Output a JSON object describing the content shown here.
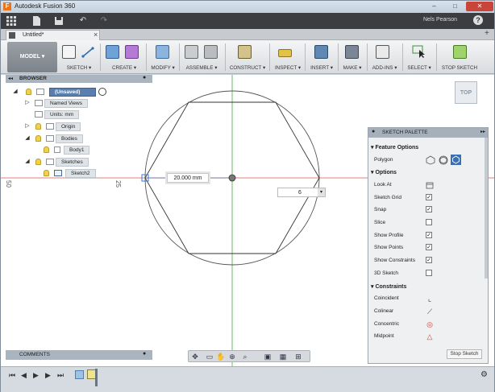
{
  "window": {
    "title": "Autodesk Fusion 360",
    "app_icon": "F",
    "minimize": "–",
    "maximize": "□",
    "close": "✕"
  },
  "quickbar": {
    "user_name": "Nels Pearson",
    "help": "?"
  },
  "document": {
    "tab_label": "Untitled*",
    "close": "×",
    "add_tab": "+"
  },
  "toolbar": {
    "workspace": "MODEL",
    "groups": [
      {
        "label": "SKETCH"
      },
      {
        "label": "CREATE"
      },
      {
        "label": "MODIFY"
      },
      {
        "label": "ASSEMBLE"
      },
      {
        "label": "CONSTRUCT"
      },
      {
        "label": "INSPECT"
      },
      {
        "label": "INSERT"
      },
      {
        "label": "MAKE"
      },
      {
        "label": "ADD-INS"
      },
      {
        "label": "SELECT"
      },
      {
        "label": "STOP SKETCH"
      }
    ]
  },
  "browser": {
    "title": "BROWSER",
    "nodes": [
      {
        "label": "(Unsaved)"
      },
      {
        "label": "Named Views"
      },
      {
        "label": "Units: mm"
      },
      {
        "label": "Origin"
      },
      {
        "label": "Bodies"
      },
      {
        "label": "Body1"
      },
      {
        "label": "Sketches"
      },
      {
        "label": "Sketch2"
      }
    ]
  },
  "canvas": {
    "viewcube": "TOP",
    "ruler_labels": [
      "50",
      "25"
    ],
    "dimension_value": "20.000 mm",
    "sides_value": "6",
    "colors": {
      "x_axis": "#d9544c",
      "y_axis": "#3fae3f",
      "sketch": "#333333",
      "construction": "#666666"
    }
  },
  "palette": {
    "title": "SKETCH PALETTE",
    "feature_options": {
      "header": "Feature Options",
      "polygon_label": "Polygon",
      "polygon_types": [
        "circumscribed-polygon-icon",
        "inscribed-polygon-icon",
        "edge-polygon-icon"
      ]
    },
    "options": {
      "header": "Options",
      "rows": [
        {
          "label": "Look At",
          "kind": "icon",
          "checked": false
        },
        {
          "label": "Sketch Grid",
          "kind": "check",
          "checked": true
        },
        {
          "label": "Snap",
          "kind": "check",
          "checked": true
        },
        {
          "label": "Slice",
          "kind": "check",
          "checked": false
        },
        {
          "label": "Show Profile",
          "kind": "check",
          "checked": true
        },
        {
          "label": "Show Points",
          "kind": "check",
          "checked": true
        },
        {
          "label": "Show Constraints",
          "kind": "check",
          "checked": true
        },
        {
          "label": "3D Sketch",
          "kind": "check",
          "checked": false
        }
      ]
    },
    "constraints": {
      "header": "Constraints",
      "rows": [
        {
          "label": "Coincident",
          "glyph": "⌞"
        },
        {
          "label": "Colinear",
          "glyph": "⟋"
        },
        {
          "label": "Concentric",
          "glyph": "◎"
        },
        {
          "label": "Midpoint",
          "glyph": "△"
        }
      ]
    },
    "stop_button": "Stop Sketch"
  },
  "comments": {
    "title": "COMMENTS"
  }
}
